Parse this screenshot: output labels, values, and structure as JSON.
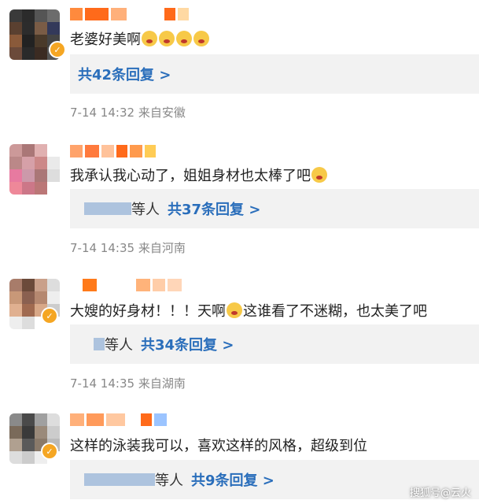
{
  "comments": [
    {
      "text": "老婆好美啊",
      "reply_users": "",
      "reply_link": "共42条回复 >",
      "time": "7-14 14:32",
      "location": "来自安徽"
    },
    {
      "text": "我承认我心动了，姐姐身材也太棒了吧",
      "reply_users": "等人",
      "reply_link": "共37条回复 >",
      "time": "7-14 14:35",
      "location": "来自河南"
    },
    {
      "text_a": "大嫂的好身材！！！天啊",
      "text_b": "这谁看了不迷糊，也太美了吧",
      "reply_users": "等人",
      "reply_link": "共34条回复 >",
      "time": "7-14 14:35",
      "location": "来自湖南"
    },
    {
      "text": "这样的泳装我可以，喜欢这样的风格，超级到位",
      "reply_users": "等人",
      "reply_link": "共9条回复 >"
    }
  ],
  "watermark": "搜狐号@云火",
  "colors": {
    "link": "#2a6ebb",
    "meta": "#888888",
    "reply_bg": "#f2f2f2"
  }
}
